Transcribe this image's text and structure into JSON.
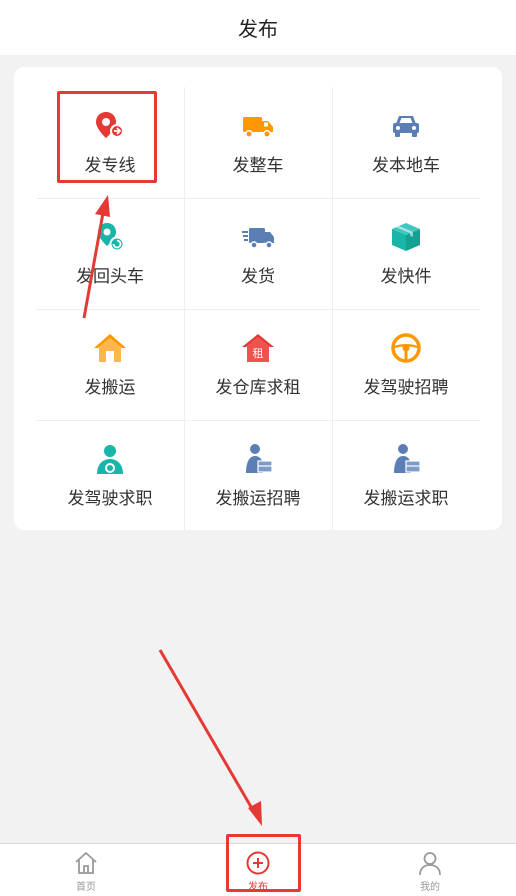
{
  "header": {
    "title": "发布"
  },
  "grid": {
    "items": [
      {
        "label": "发专线",
        "icon": "location-pin-icon"
      },
      {
        "label": "发整车",
        "icon": "truck-icon"
      },
      {
        "label": "发本地车",
        "icon": "car-icon"
      },
      {
        "label": "发回头车",
        "icon": "return-route-icon"
      },
      {
        "label": "发货",
        "icon": "delivery-truck-icon"
      },
      {
        "label": "发快件",
        "icon": "package-icon"
      },
      {
        "label": "发搬运",
        "icon": "house-icon"
      },
      {
        "label": "发仓库求租",
        "icon": "rent-house-icon"
      },
      {
        "label": "发驾驶招聘",
        "icon": "steering-wheel-icon"
      },
      {
        "label": "发驾驶求职",
        "icon": "driver-person-icon"
      },
      {
        "label": "发搬运招聘",
        "icon": "mover-person-icon"
      },
      {
        "label": "发搬运求职",
        "icon": "mover-person-icon"
      }
    ],
    "rent_badge": "租"
  },
  "tabbar": {
    "items": [
      {
        "label": "首页",
        "icon": "home-icon",
        "active": false
      },
      {
        "label": "发布",
        "icon": "plus-circle-icon",
        "active": true
      },
      {
        "label": "我的",
        "icon": "person-icon",
        "active": false
      }
    ]
  },
  "colors": {
    "accent": "#e53935",
    "orange": "#ff9800",
    "blue": "#5b7fb5",
    "teal": "#18b6a8",
    "background": "#f2f2f2",
    "annotation": "#e53935"
  }
}
